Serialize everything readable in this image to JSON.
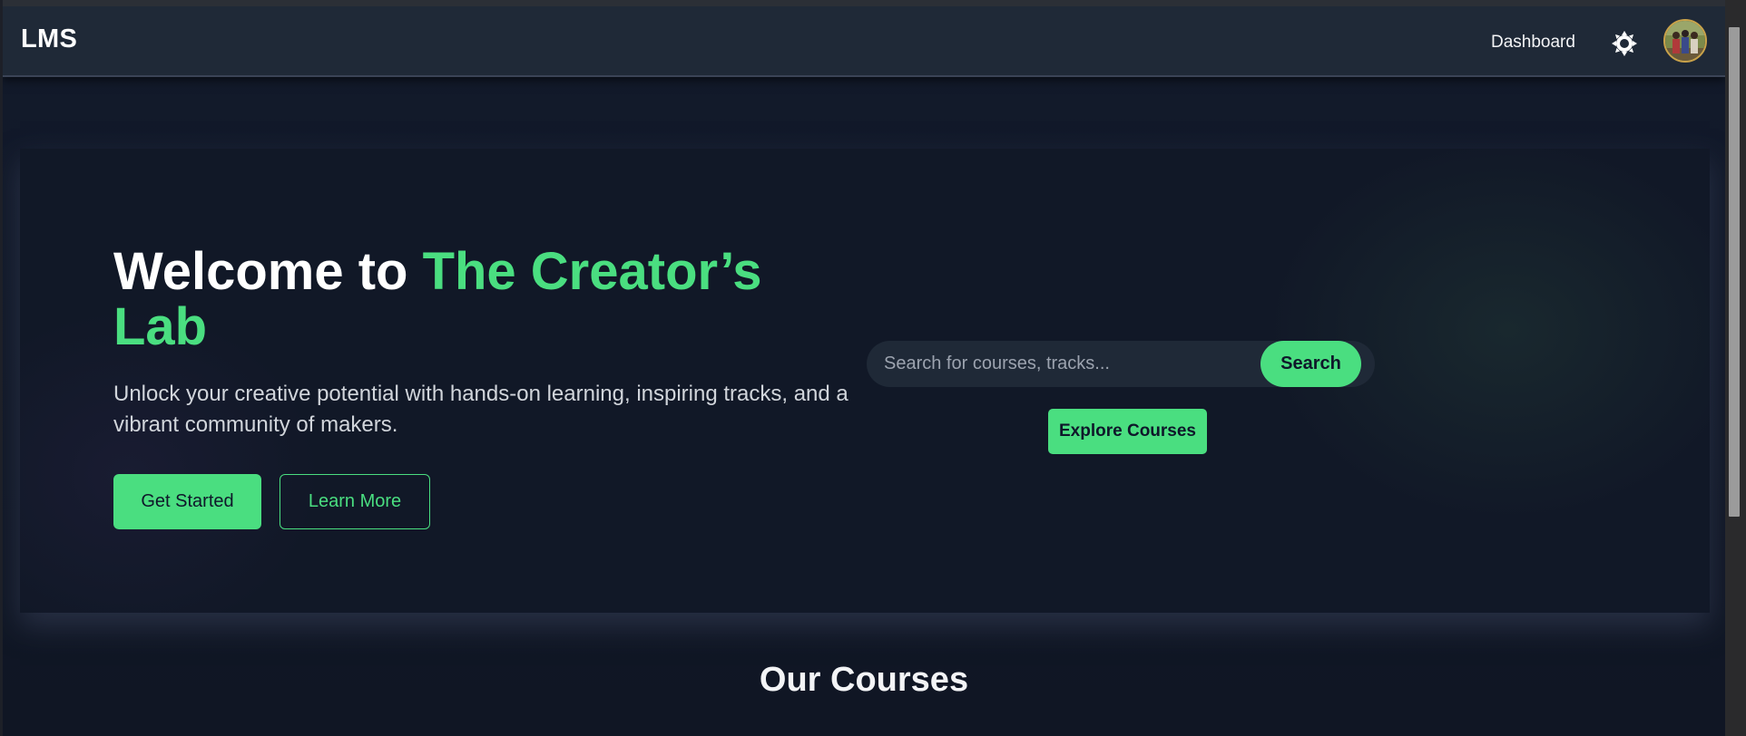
{
  "navbar": {
    "logo": "LMS",
    "dashboard_link": "Dashboard",
    "theme_icon": "sun-icon",
    "avatar_icon": "user-avatar"
  },
  "hero": {
    "title_prefix": "Welcome to ",
    "title_accent": "The Creator’s Lab",
    "subtitle": "Unlock your creative potential with hands-on learning, inspiring tracks, and a vibrant community of makers.",
    "get_started_label": "Get Started",
    "learn_more_label": "Learn More",
    "search": {
      "placeholder": "Search for courses, tracks...",
      "value": "",
      "button_label": "Search"
    },
    "explore_label": "Explore Courses"
  },
  "courses": {
    "title": "Our Courses"
  },
  "colors": {
    "accent": "#4ade80",
    "background": "#111827",
    "navbar": "#1f2937"
  }
}
